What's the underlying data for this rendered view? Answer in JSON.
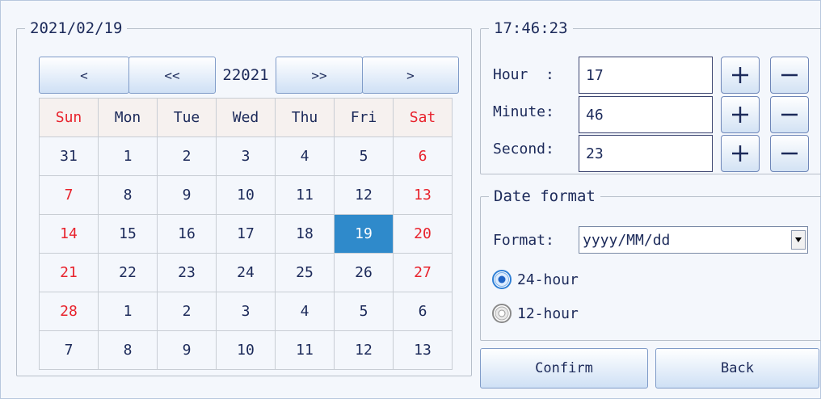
{
  "calendar": {
    "selected_date": "2021/02/19",
    "year_label": "22021",
    "nav": {
      "prev_month": "<",
      "prev_year": "<<",
      "next_year": ">>",
      "next_month": ">"
    },
    "weekdays": [
      "Sun",
      "Mon",
      "Tue",
      "Wed",
      "Thu",
      "Fri",
      "Sat"
    ],
    "weeks": [
      [
        "31",
        "1",
        "2",
        "3",
        "4",
        "5",
        "6"
      ],
      [
        "7",
        "8",
        "9",
        "10",
        "11",
        "12",
        "13"
      ],
      [
        "14",
        "15",
        "16",
        "17",
        "18",
        "19",
        "20"
      ],
      [
        "21",
        "22",
        "23",
        "24",
        "25",
        "26",
        "27"
      ],
      [
        "28",
        "1",
        "2",
        "3",
        "4",
        "5",
        "6"
      ],
      [
        "7",
        "8",
        "9",
        "10",
        "11",
        "12",
        "13"
      ]
    ],
    "weekend_color": "#e8232d",
    "selected_color": "#2f8acb"
  },
  "time": {
    "current": "17:46:23",
    "hour_label": "Hour  :",
    "minute_label": "Minute:",
    "second_label": "Second:",
    "hour_value": "17",
    "minute_value": "46",
    "second_value": "23"
  },
  "date_format": {
    "title": "Date format",
    "format_label": "Format:",
    "format_value": "yyyy/MM/dd",
    "option_24": "24-hour",
    "option_12": "12-hour",
    "selected_option": "24-hour"
  },
  "actions": {
    "confirm": "Confirm",
    "back": "Back"
  },
  "colors": {
    "accent": "#2f8acb",
    "weekend": "#e8232d",
    "text": "#1c2a5a"
  }
}
